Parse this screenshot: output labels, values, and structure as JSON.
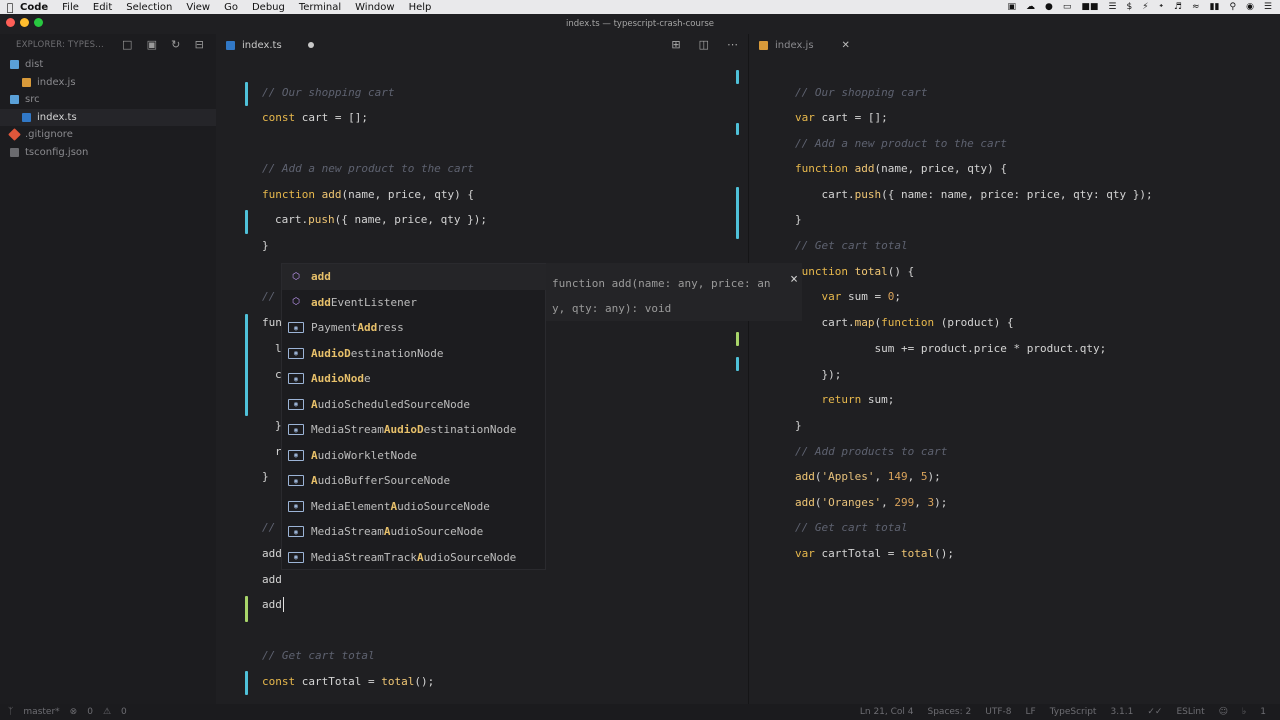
{
  "menubar": {
    "app": "Code",
    "items": [
      "File",
      "Edit",
      "Selection",
      "View",
      "Go",
      "Debug",
      "Terminal",
      "Window",
      "Help"
    ]
  },
  "window": {
    "title": "index.ts — typescript-crash-course"
  },
  "explorer": {
    "header": "EXPLORER: TYPES...",
    "items": [
      {
        "label": "dist",
        "kind": "folder"
      },
      {
        "label": "index.js",
        "kind": "js"
      },
      {
        "label": "src",
        "kind": "folder"
      },
      {
        "label": "index.ts",
        "kind": "ts"
      },
      {
        "label": ".gitignore",
        "kind": "git"
      },
      {
        "label": "tsconfig.json",
        "kind": "json"
      }
    ]
  },
  "left_tab": {
    "label": "index.ts"
  },
  "right_tab": {
    "label": "index.js"
  },
  "left_code": [
    "// Our shopping cart",
    "const cart = [];",
    "",
    "// Add a new product to the cart",
    "function add(name, price, qty) {",
    "  cart.push({ name, price, qty });",
    "}",
    "// ",
    "fun",
    "  l",
    "  c",
    "  }",
    "  r",
    "}",
    "// ",
    "add",
    "add",
    "add",
    "// Get cart total",
    "const cartTotal = total();"
  ],
  "right_code": [
    "// Our shopping cart",
    "var cart = [];",
    "// Add a new product to the cart",
    "function add(name, price, qty) {",
    "    cart.push({ name: name, price: price, qty: qty });",
    "}",
    "// Get cart total",
    "function total() {",
    "    var sum = 0;",
    "    cart.map(function (product) {",
    "        sum += product.price * product.qty;",
    "    });",
    "    return sum;",
    "}",
    "// Add products to cart",
    "add('Apples', 149, 5);",
    "add('Oranges', 299, 3);",
    "// Get cart total",
    "var cartTotal = total();"
  ],
  "suggestions": [
    {
      "pre": "",
      "hl": "add",
      "post": "",
      "kind": "method"
    },
    {
      "pre": "",
      "hl": "add",
      "post": "EventListener",
      "kind": "method"
    },
    {
      "pre": "Payment",
      "hl": "Add",
      "post": "ress",
      "kind": "class"
    },
    {
      "pre": "",
      "hl": "AudioD",
      "post": "estinationNode",
      "kind": "class"
    },
    {
      "pre": "",
      "hl": "AudioNod",
      "post": "e",
      "kind": "class"
    },
    {
      "pre": "",
      "hl": "A",
      "post": "udioScheduledSourceNode",
      "kind": "class"
    },
    {
      "pre": "MediaStream",
      "hl": "AudioD",
      "post": "estinationNode",
      "kind": "class"
    },
    {
      "pre": "",
      "hl": "A",
      "post": "udioWorkletNode",
      "kind": "class"
    },
    {
      "pre": "",
      "hl": "A",
      "post": "udioBufferSourceNode",
      "kind": "class"
    },
    {
      "pre": "MediaElement",
      "hl": "A",
      "post": "udioSourceNode",
      "kind": "class"
    },
    {
      "pre": "MediaStream",
      "hl": "A",
      "post": "udioSourceNode",
      "kind": "class"
    },
    {
      "pre": "MediaStreamTrack",
      "hl": "A",
      "post": "udioSourceNode",
      "kind": "class"
    }
  ],
  "detail": {
    "line1": "function add(name: any, price: an",
    "line2": "y, qty: any): void",
    "close": "×"
  },
  "statusbar": {
    "branch": "master*",
    "errors": "0",
    "warnings": "0",
    "position": "Ln 21, Col 4",
    "spaces": "Spaces: 2",
    "encoding": "UTF-8",
    "eol": "LF",
    "language": "TypeScript",
    "version": "3.1.1",
    "linter": "ESLint",
    "notifications": "1"
  },
  "colors": {
    "accent_cyan": "#4fc1d9",
    "accent_green": "#a8d56a",
    "keyword": "#e7b84c",
    "comment": "#5e6270"
  }
}
